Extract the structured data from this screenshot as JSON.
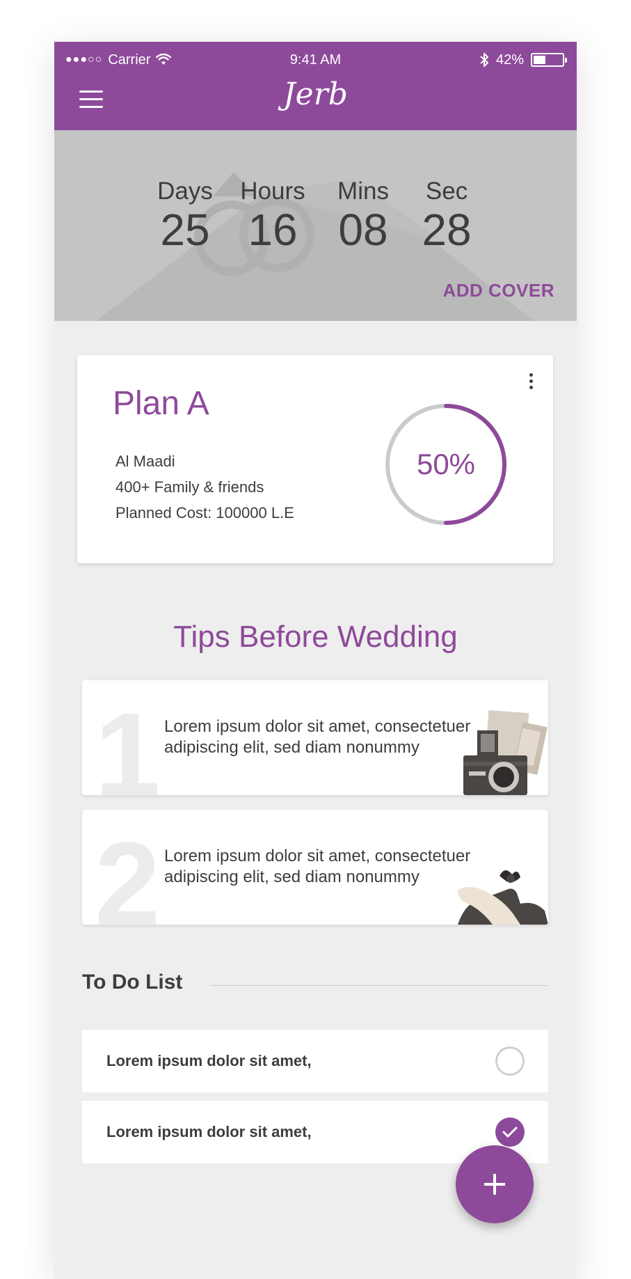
{
  "status_bar": {
    "signal_dots": "●●●○○",
    "carrier": "Carrier",
    "wifi_icon": "wifi-icon",
    "time": "9:41 AM",
    "bluetooth_icon": "bluetooth-icon",
    "battery_percent": "42%",
    "battery_level": 0.42
  },
  "header": {
    "logo": "Jerb",
    "menu_icon": "hamburger-menu-icon"
  },
  "countdown": {
    "units": [
      {
        "label": "Days",
        "value": "25"
      },
      {
        "label": "Hours",
        "value": "16"
      },
      {
        "label": "Mins",
        "value": "08"
      },
      {
        "label": "Sec",
        "value": "28"
      }
    ],
    "add_cover_label": "ADD COVER"
  },
  "plan": {
    "title": "Plan A",
    "location": "Al Maadi",
    "guests": "400+ Family & friends",
    "cost": "Planned Cost: 100000 L.E",
    "progress_text": "50%",
    "progress": 0.5
  },
  "tips": {
    "title": "Tips Before Wedding",
    "items": [
      {
        "number": "1",
        "text": "Lorem ipsum dolor sit amet, consectetuer adipiscing elit, sed diam nonummy",
        "icon": "camera-illustration"
      },
      {
        "number": "2",
        "text": "Lorem ipsum dolor sit amet, consectetuer adipiscing elit, sed diam nonummy",
        "icon": "shoes-illustration"
      }
    ]
  },
  "todo": {
    "title": "To Do List",
    "items": [
      {
        "text": "Lorem ipsum dolor sit amet,",
        "done": false
      },
      {
        "text": "Lorem ipsum dolor sit amet,",
        "done": true
      }
    ]
  },
  "fab_icon": "plus-icon",
  "colors": {
    "accent": "#8e4a9a",
    "background": "#eeeeee",
    "cover": "#c4c4c4",
    "text": "#3d3d3d"
  }
}
